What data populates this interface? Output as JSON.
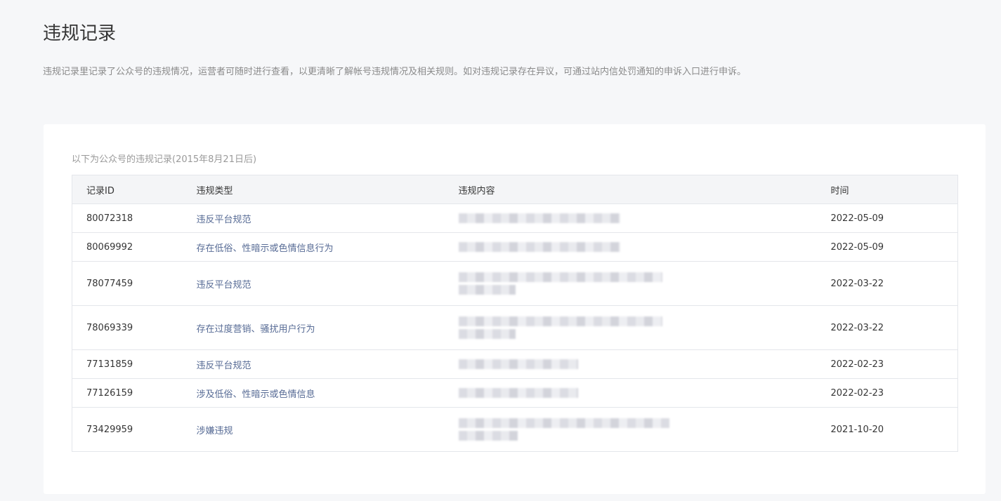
{
  "header": {
    "title": "违规记录",
    "description": "违规记录里记录了公众号的违规情况，运营者可随时进行查看，以更清晰了解帐号违规情况及相关规则。如对违规记录存在异议，可通过站内信处罚通知的申诉入口进行申诉。"
  },
  "card": {
    "subtitle": "以下为公众号的违规记录(2015年8月21日后)",
    "columns": [
      "记录ID",
      "违规类型",
      "违规内容",
      "时间"
    ],
    "rows": [
      {
        "id": "80072318",
        "type": "违反平台规范",
        "date": "2022-05-09",
        "content_lines": 1,
        "blur_width": 230
      },
      {
        "id": "80069992",
        "type": "存在低俗、性暗示或色情信息行为",
        "date": "2022-05-09",
        "content_lines": 1,
        "blur_width": 230
      },
      {
        "id": "78077459",
        "type": "违反平台规范",
        "date": "2022-03-22",
        "content_lines": 2,
        "blur_width": 290
      },
      {
        "id": "78069339",
        "type": "存在过度营销、骚扰用户行为",
        "date": "2022-03-22",
        "content_lines": 2,
        "blur_width": 290
      },
      {
        "id": "77131859",
        "type": "违反平台规范",
        "date": "2022-02-23",
        "content_lines": 1,
        "blur_width": 170
      },
      {
        "id": "77126159",
        "type": "涉及低俗、性暗示或色情信息",
        "date": "2022-02-23",
        "content_lines": 1,
        "blur_width": 170
      },
      {
        "id": "73429959",
        "type": "涉嫌违规",
        "date": "2021-10-20",
        "content_lines": 2,
        "blur_width": 300
      }
    ]
  }
}
